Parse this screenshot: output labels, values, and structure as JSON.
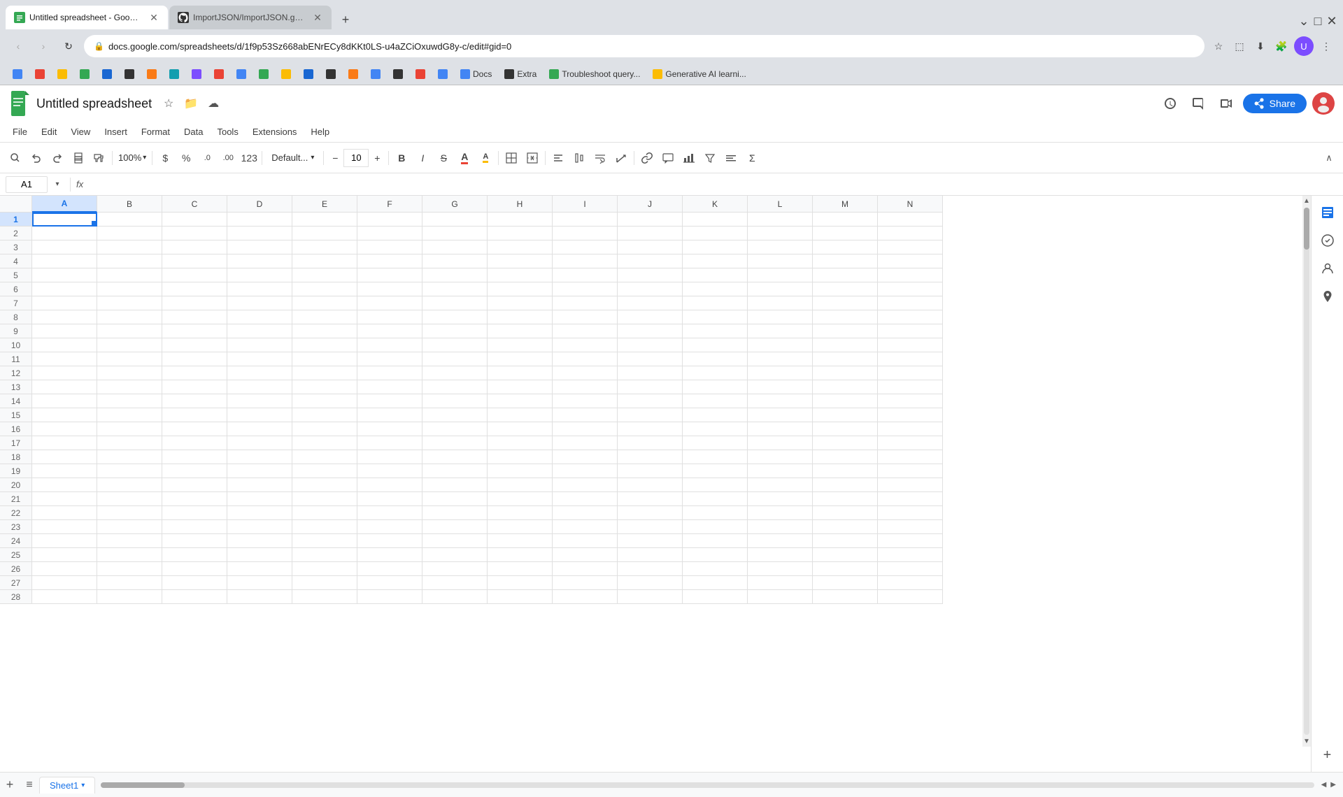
{
  "browser": {
    "tabs": [
      {
        "id": "tab1",
        "title": "Untitled spreadsheet - Google S",
        "favicon_color": "#34a853",
        "active": true
      },
      {
        "id": "tab2",
        "title": "ImportJSON/ImportJSON.gs at r",
        "favicon_color": "#333",
        "active": false
      }
    ],
    "url": "docs.google.com/spreadsheets/d/1f9p53Sz668abENrECy8dKKt0LS-u4aZCiOxuwdG8y-c/edit#gid=0",
    "new_tab_label": "+",
    "bookmarks": [
      {
        "label": "",
        "favicon_color": "#4285f4"
      },
      {
        "label": "",
        "favicon_color": "#ea4335"
      },
      {
        "label": "",
        "favicon_color": "#fbbc04"
      },
      {
        "label": "",
        "favicon_color": "#34a853"
      },
      {
        "label": "",
        "favicon_color": "#1967d2"
      },
      {
        "label": "",
        "favicon_color": "#333"
      },
      {
        "label": "",
        "favicon_color": "#fa7b17"
      },
      {
        "label": "",
        "favicon_color": "#129eaf"
      },
      {
        "label": "",
        "favicon_color": "#7c4dff"
      },
      {
        "label": "",
        "favicon_color": "#ea4335"
      },
      {
        "label": "",
        "favicon_color": "#4285f4"
      },
      {
        "label": "",
        "favicon_color": "#34a853"
      },
      {
        "label": "",
        "favicon_color": "#fbbc04"
      },
      {
        "label": "",
        "favicon_color": "#1967d2"
      },
      {
        "label": "",
        "favicon_color": "#333"
      },
      {
        "label": "",
        "favicon_color": "#fa7b17"
      },
      {
        "label": "",
        "favicon_color": "#4285f4"
      },
      {
        "label": "",
        "favicon_color": "#333"
      },
      {
        "label": "",
        "favicon_color": "#ea4335"
      },
      {
        "label": "",
        "favicon_color": "#4285f4"
      },
      {
        "label": "Docs",
        "favicon_color": "#4285f4"
      },
      {
        "label": "Extra",
        "favicon_color": "#333"
      },
      {
        "label": "Troubleshoot query...",
        "favicon_color": "#34a853"
      },
      {
        "label": "Generative AI learni...",
        "favicon_color": "#fbbc04"
      }
    ]
  },
  "app": {
    "title": "Untitled spreadsheet",
    "logo_text": "S",
    "menu": [
      "File",
      "Edit",
      "View",
      "Insert",
      "Format",
      "Data",
      "Tools",
      "Extensions",
      "Help"
    ],
    "share_label": "Share",
    "cell_ref": "A1",
    "formula_label": "fx"
  },
  "toolbar": {
    "zoom": "100%",
    "format_type": "Default...",
    "font_size": "10",
    "currency": "$",
    "percent": "%",
    "decimal_decrease": ".0",
    "decimal_increase": ".00",
    "number_format": "123"
  },
  "columns": [
    "A",
    "B",
    "C",
    "D",
    "E",
    "F",
    "G",
    "H",
    "I",
    "J",
    "K",
    "L",
    "M",
    "N"
  ],
  "rows": [
    1,
    2,
    3,
    4,
    5,
    6,
    7,
    8,
    9,
    10,
    11,
    12,
    13,
    14,
    15,
    16,
    17,
    18,
    19,
    20,
    21,
    22,
    23,
    24,
    25,
    26,
    27,
    28
  ],
  "sheet_tabs": [
    {
      "label": "Sheet1",
      "active": true
    }
  ]
}
